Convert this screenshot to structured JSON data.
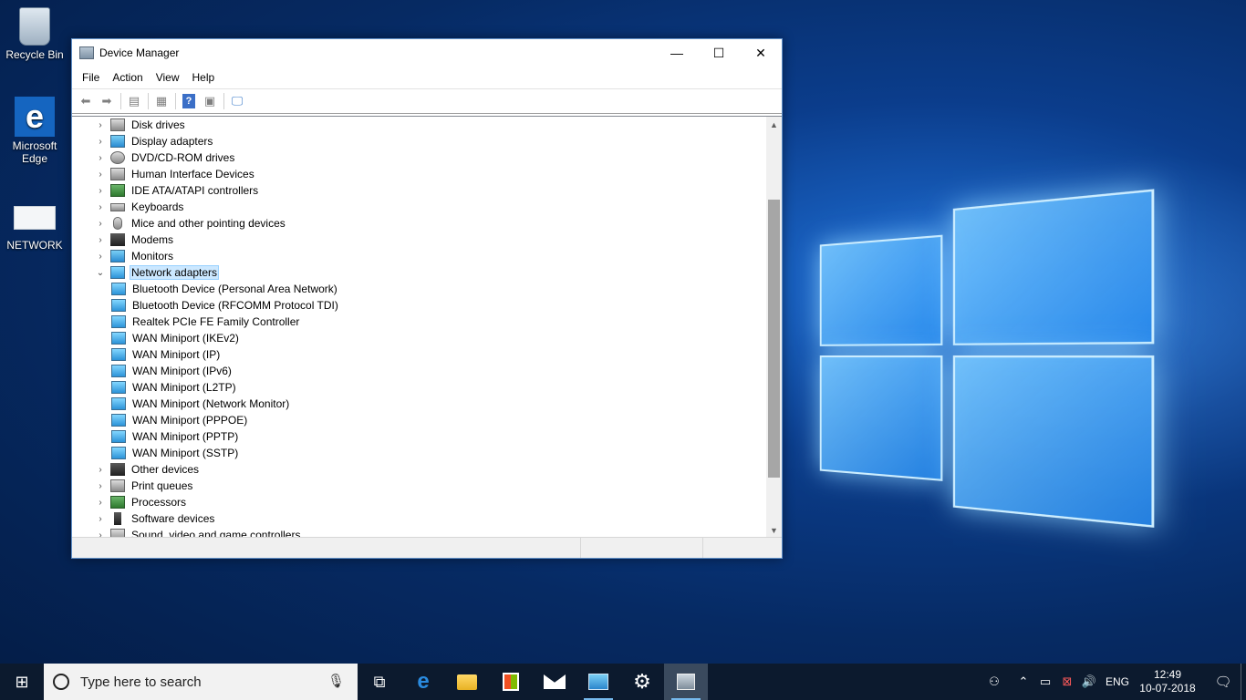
{
  "desktop": {
    "icons": [
      {
        "label": "Recycle Bin"
      },
      {
        "label": "Microsoft Edge"
      },
      {
        "label": "NETWORK"
      }
    ]
  },
  "window": {
    "title": "Device Manager",
    "controls": {
      "minimize": "—",
      "maximize": "☐",
      "close": "✕"
    },
    "menu": [
      "File",
      "Action",
      "View",
      "Help"
    ],
    "tree": {
      "categories_before": [
        {
          "label": "Disk drives",
          "icon": "disk-drive-icon"
        },
        {
          "label": "Display adapters",
          "icon": "display-adapter-icon"
        },
        {
          "label": "DVD/CD-ROM drives",
          "icon": "dvd-drive-icon"
        },
        {
          "label": "Human Interface Devices",
          "icon": "hid-icon"
        },
        {
          "label": "IDE ATA/ATAPI controllers",
          "icon": "ide-controller-icon"
        },
        {
          "label": "Keyboards",
          "icon": "keyboard-icon"
        },
        {
          "label": "Mice and other pointing devices",
          "icon": "mouse-icon"
        },
        {
          "label": "Modems",
          "icon": "modem-icon"
        },
        {
          "label": "Monitors",
          "icon": "monitor-icon"
        }
      ],
      "expanded": {
        "label": "Network adapters",
        "children": [
          "Bluetooth Device (Personal Area Network)",
          "Bluetooth Device (RFCOMM Protocol TDI)",
          "Realtek PCIe FE Family Controller",
          "WAN Miniport (IKEv2)",
          "WAN Miniport (IP)",
          "WAN Miniport (IPv6)",
          "WAN Miniport (L2TP)",
          "WAN Miniport (Network Monitor)",
          "WAN Miniport (PPPOE)",
          "WAN Miniport (PPTP)",
          "WAN Miniport (SSTP)"
        ]
      },
      "categories_after": [
        {
          "label": "Other devices",
          "icon": "other-devices-icon"
        },
        {
          "label": "Print queues",
          "icon": "printer-icon"
        },
        {
          "label": "Processors",
          "icon": "processor-icon"
        },
        {
          "label": "Software devices",
          "icon": "software-device-icon"
        },
        {
          "label": "Sound, video and game controllers",
          "icon": "sound-controller-icon"
        }
      ]
    }
  },
  "taskbar": {
    "search_placeholder": "Type here to search",
    "language": "ENG",
    "time": "12:49",
    "date": "10-07-2018"
  }
}
